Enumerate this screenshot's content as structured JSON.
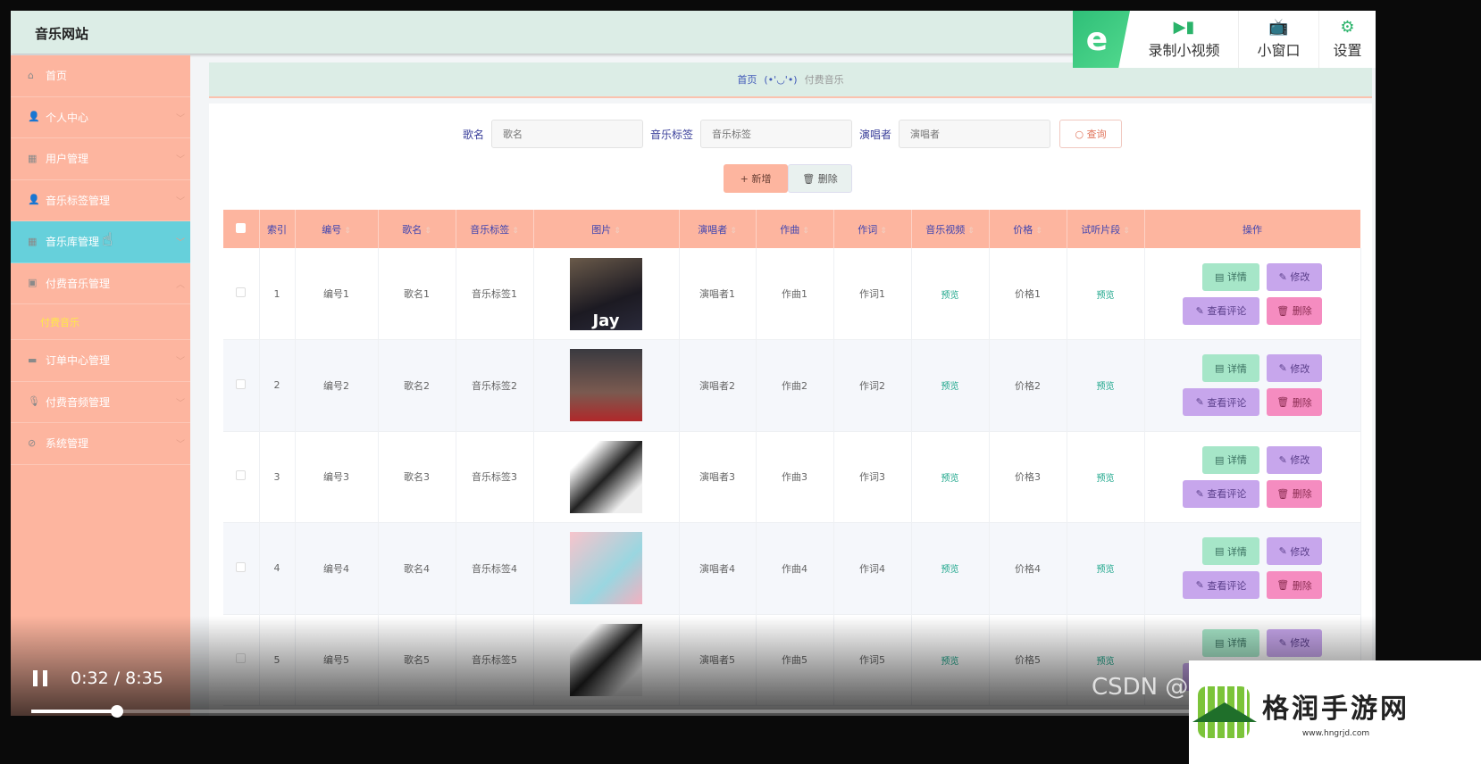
{
  "app": {
    "title": "音乐网站"
  },
  "sidebar": {
    "items": [
      {
        "label": "首页",
        "icon": "home-icon"
      },
      {
        "label": "个人中心",
        "icon": "user-icon",
        "chevron": "down"
      },
      {
        "label": "用户管理",
        "icon": "chart-icon",
        "chevron": "down"
      },
      {
        "label": "音乐标签管理",
        "icon": "user-icon",
        "chevron": "down"
      },
      {
        "label": "音乐库管理",
        "icon": "grid-icon",
        "chevron": "down",
        "active": true
      },
      {
        "label": "付费音乐管理",
        "icon": "picture-icon",
        "chevron": "up"
      },
      {
        "label": "订单中心管理",
        "icon": "chat-icon",
        "chevron": "down"
      },
      {
        "label": "付费音频管理",
        "icon": "mic-icon",
        "chevron": "down"
      },
      {
        "label": "系统管理",
        "icon": "settings-icon",
        "chevron": "down"
      }
    ],
    "subitem": "付费音乐"
  },
  "breadcrumb": {
    "home": "首页",
    "face": "(•'◡'•)",
    "current": "付费音乐"
  },
  "search": {
    "song_label": "歌名",
    "song_placeholder": "歌名",
    "tag_label": "音乐标签",
    "tag_placeholder": "音乐标签",
    "singer_label": "演唱者",
    "singer_placeholder": "演唱者",
    "query": "查询"
  },
  "actions": {
    "add": "新增",
    "delete": "删除"
  },
  "table": {
    "headers": [
      "索引",
      "编号",
      "歌名",
      "音乐标签",
      "图片",
      "演唱者",
      "作曲",
      "作词",
      "音乐视频",
      "价格",
      "试听片段",
      "操作"
    ],
    "rows": [
      {
        "index": "1",
        "code": "编号1",
        "name": "歌名1",
        "tag": "音乐标签1",
        "singer": "演唱者1",
        "composer": "作曲1",
        "lyricist": "作词1",
        "video": "预览",
        "price": "价格1",
        "clip": "预览",
        "cover_text": "Jay"
      },
      {
        "index": "2",
        "code": "编号2",
        "name": "歌名2",
        "tag": "音乐标签2",
        "singer": "演唱者2",
        "composer": "作曲2",
        "lyricist": "作词2",
        "video": "预览",
        "price": "价格2",
        "clip": "预览",
        "cover_text": ""
      },
      {
        "index": "3",
        "code": "编号3",
        "name": "歌名3",
        "tag": "音乐标签3",
        "singer": "演唱者3",
        "composer": "作曲3",
        "lyricist": "作词3",
        "video": "预览",
        "price": "价格3",
        "clip": "预览",
        "cover_text": ""
      },
      {
        "index": "4",
        "code": "编号4",
        "name": "歌名4",
        "tag": "音乐标签4",
        "singer": "演唱者4",
        "composer": "作曲4",
        "lyricist": "作词4",
        "video": "预览",
        "price": "价格4",
        "clip": "预览",
        "cover_text": ""
      },
      {
        "index": "5",
        "code": "编号5",
        "name": "歌名5",
        "tag": "音乐标签5",
        "singer": "演唱者5",
        "composer": "作曲5",
        "lyricist": "作词5",
        "video": "预览",
        "price": "价格5",
        "clip": "预览",
        "cover_text": ""
      }
    ],
    "row_actions": {
      "detail": "详情",
      "edit": "修改",
      "comment": "查看评论",
      "delete": "删除"
    }
  },
  "browser_bar": {
    "logo": "e",
    "record": "录制小视频",
    "mini": "小窗口",
    "settings": "设置"
  },
  "video": {
    "time": "0:32 / 8:35",
    "progress": 0.064,
    "state": "playing"
  },
  "watermark": {
    "csdn": "CSDN @",
    "site": "格润手游网",
    "url": "www.hngrjd.com"
  },
  "colors": {
    "sidebar": "#fdb59f",
    "active": "#66d0db",
    "header": "#dcede6",
    "accent": "#3f44b0"
  }
}
